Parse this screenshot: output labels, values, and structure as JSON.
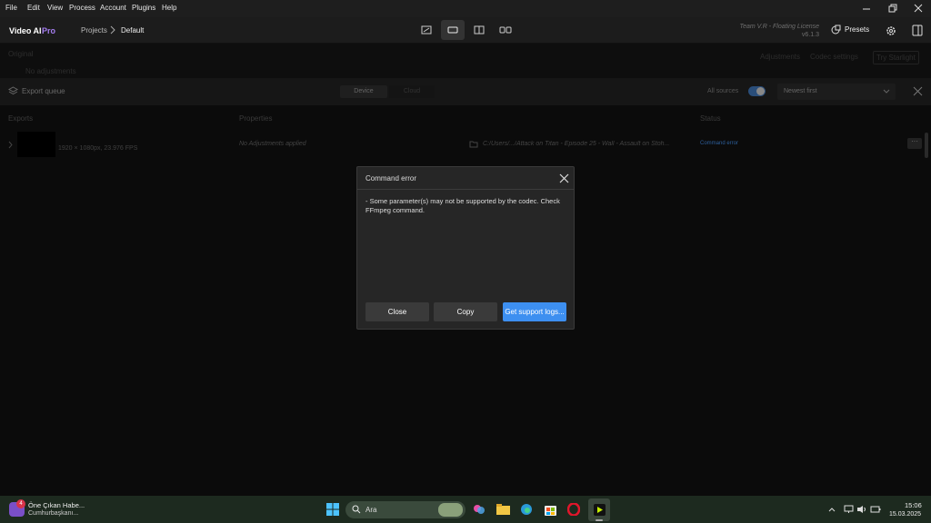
{
  "menu": [
    "File",
    "Edit",
    "View",
    "Process",
    "Account",
    "Plugins",
    "Help"
  ],
  "header": {
    "app_name": "Video AI",
    "app_tier": "Pro",
    "breadcrumb_parent": "Projects",
    "breadcrumb_current": "Default",
    "license": "Team V.R - Floating License",
    "version": "v6.1.3",
    "presets_label": "Presets"
  },
  "dimbar": {
    "original_label": "Original",
    "no_adjustments": "No adjustments",
    "adjustments_tab": "Adjustments",
    "codec_settings_tab": "Codec settings",
    "try_starlight": "Try Starlight"
  },
  "queue": {
    "title": "Export queue",
    "device_tab": "Device",
    "cloud_tab": "Cloud",
    "all_sources": "All sources",
    "sort": "Newest first",
    "columns": {
      "exports": "Exports",
      "properties": "Properties",
      "status": "Status"
    },
    "row": {
      "resolution": "1920 × 1080px, 23.976 FPS",
      "properties": "No Adjustments applied",
      "path": "C:/Users/.../Attack on Titan - Episode 25 - Wall - Assault on Stoh...",
      "status": "Command error"
    }
  },
  "dialog": {
    "title": "Command error",
    "message": "- Some parameter(s) may not be supported by the codec. Check FFmpeg command.",
    "close_label": "Close",
    "copy_label": "Copy",
    "support_label": "Get support logs..."
  },
  "taskbar": {
    "news_badge": "4",
    "news_title": "Öne Çıkan Habe...",
    "news_sub": "Cumhurbaşkanı...",
    "search_placeholder": "Ara",
    "time": "15:06",
    "date": "15.03.2025"
  },
  "colors": {
    "accent": "#3d8ff0",
    "pro": "#a57ef0"
  }
}
